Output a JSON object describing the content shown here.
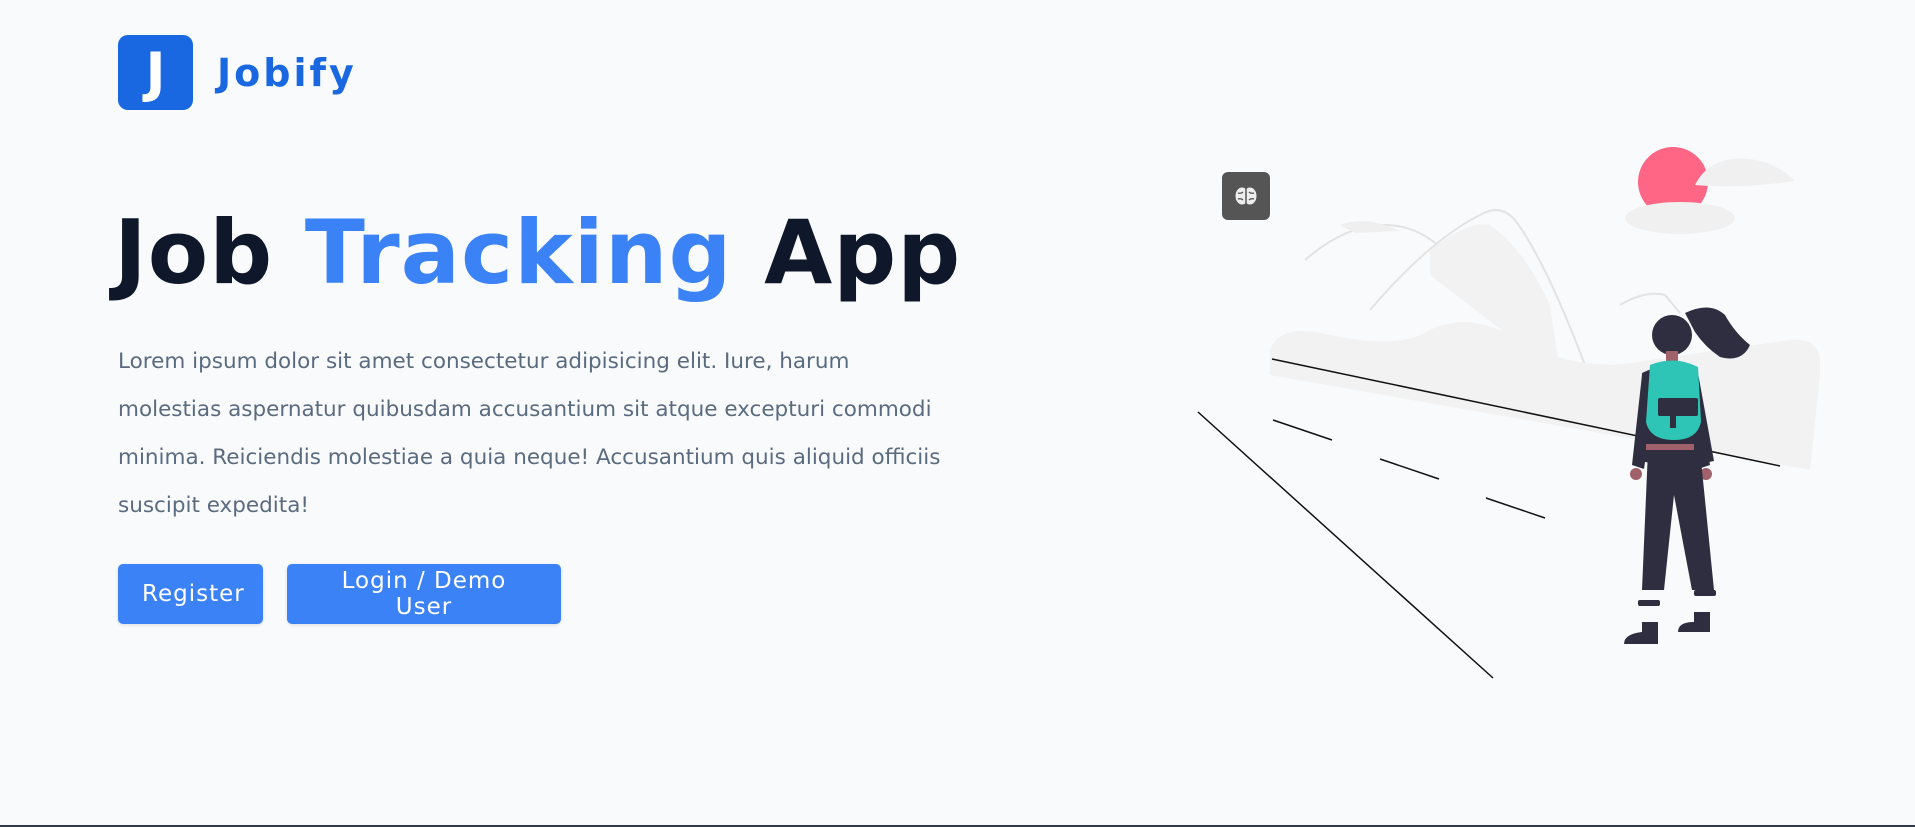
{
  "brand": {
    "logo_letter": "J",
    "name": "Jobify",
    "color": "#1968e2"
  },
  "hero": {
    "title_part1": "Job ",
    "title_accent": "Tracking",
    "title_part2": " App",
    "accent_color": "#3b82f6",
    "description": "Lorem ipsum dolor sit amet consectetur adipisicing elit. Iure, harum molestias aspernatur quibusdam accusantium sit atque excepturi commodi minima. Reiciendis molestiae a quia neque! Accusantium quis aliquid officiis suscipit expedita!"
  },
  "buttons": {
    "register_label": "Register",
    "login_label": "Login / Demo User"
  },
  "illustration": {
    "name": "woman-traveler-illustration",
    "badge_icon": "brain-icon"
  }
}
